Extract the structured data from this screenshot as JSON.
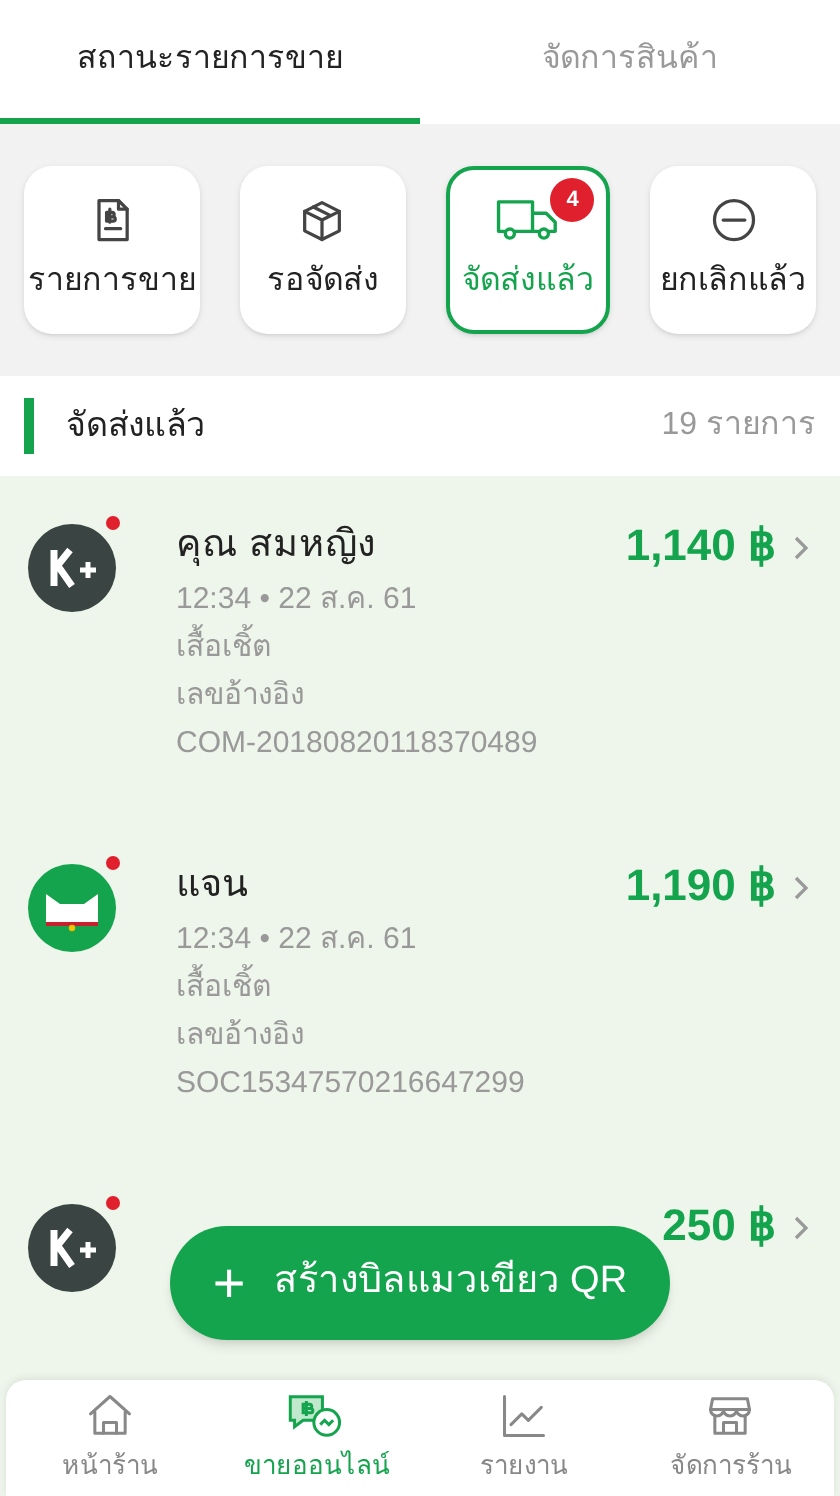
{
  "tabs": [
    {
      "label": "สถานะรายการขาย",
      "selected": true
    },
    {
      "label": "จัดการสินค้า",
      "selected": false
    }
  ],
  "categories": [
    {
      "label": "รายการขาย",
      "selected": false
    },
    {
      "label": "รอจัดส่ง",
      "selected": false
    },
    {
      "label": "จัดส่งแล้ว",
      "selected": true,
      "badge": "4"
    },
    {
      "label": "ยกเลิกแล้ว",
      "selected": false
    }
  ],
  "section": {
    "title": "จัดส่งแล้ว",
    "count": "19 รายการ"
  },
  "orders": [
    {
      "kind": "wallet",
      "unread": true,
      "name": "คุณ สมหญิง",
      "amount": "1,140 ฿",
      "time": "12:34 • 22 ส.ค. 61",
      "item": "เสื้อเชิ้ต",
      "ref_label": "เลขอ้างอิง",
      "ref": "COM-20180820118370489"
    },
    {
      "kind": "cat",
      "unread": true,
      "name": "แจน",
      "amount": "1,190 ฿",
      "time": "12:34 • 22 ส.ค. 61",
      "item": "เสื้อเชิ้ต",
      "ref_label": "เลขอ้างอิง",
      "ref": "SOC15347570216647299"
    },
    {
      "kind": "wallet",
      "unread": true,
      "amount": "250 ฿"
    }
  ],
  "fab": {
    "icon": "+",
    "label": "สร้างบิลแมวเขียว QR"
  },
  "nav": [
    {
      "label": "หน้าร้าน",
      "selected": false
    },
    {
      "label": "ขายออนไลน์",
      "selected": true
    },
    {
      "label": "รายงาน",
      "selected": false
    },
    {
      "label": "จัดการร้าน",
      "selected": false
    }
  ]
}
